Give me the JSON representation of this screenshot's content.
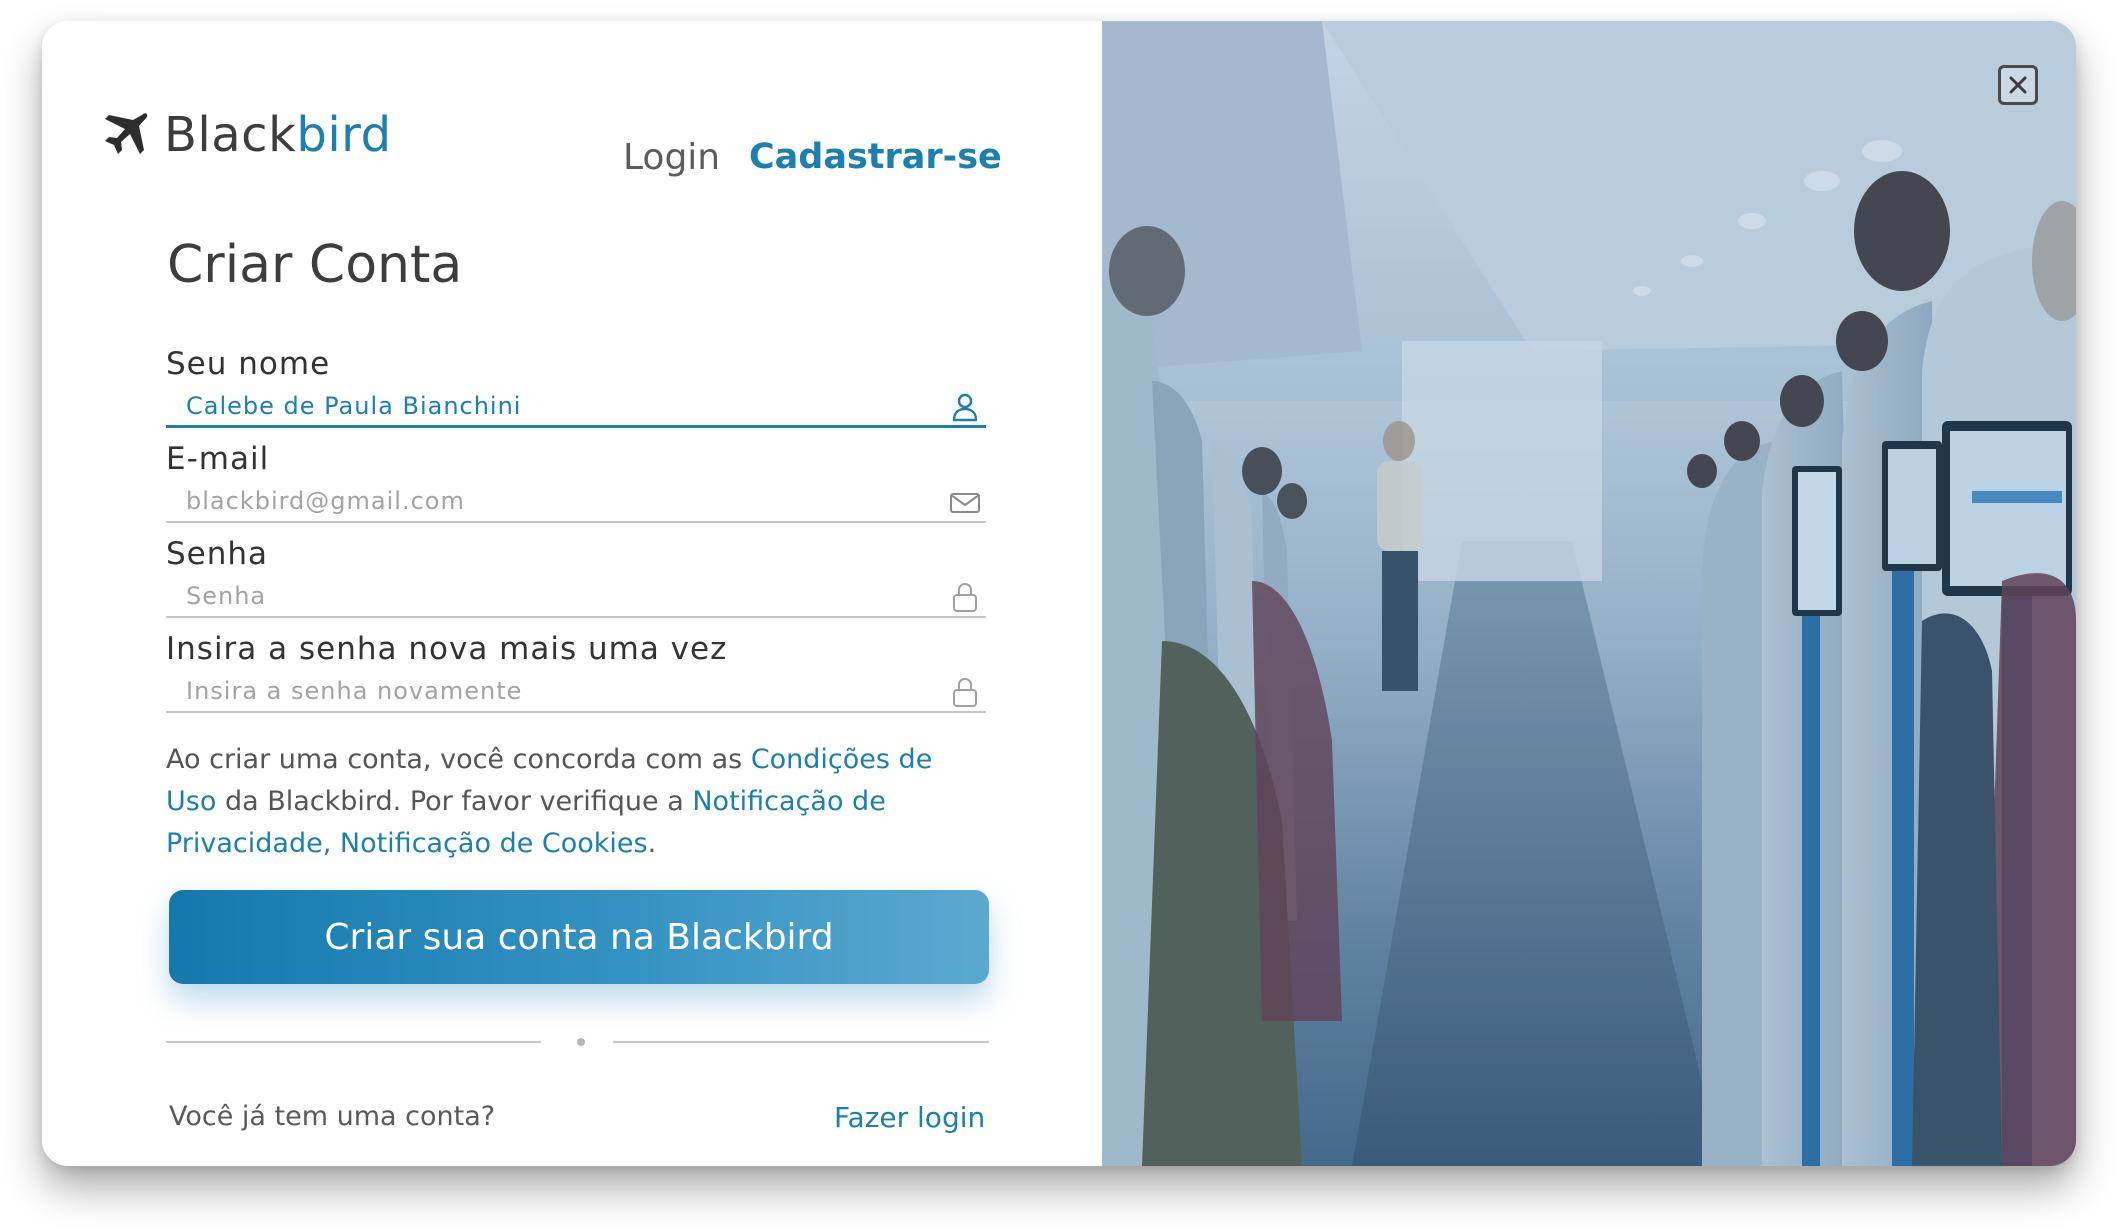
{
  "brand": {
    "name_part1": "Black",
    "name_part2": "bird",
    "icon": "airplane-icon",
    "color": "#1b7fb0"
  },
  "nav": {
    "login_label": "Login",
    "signup_label": "Cadastrar-se"
  },
  "form": {
    "title": "Criar Conta",
    "fields": [
      {
        "label": "Seu nome",
        "value": "Calebe de Paula Bianchini",
        "placeholder": "",
        "icon": "user-icon"
      },
      {
        "label": "E-mail",
        "value": "",
        "placeholder": "blackbird@gmail.com",
        "icon": "mail-icon"
      },
      {
        "label": "Senha",
        "value": "",
        "placeholder": "Senha",
        "icon": "lock-icon"
      },
      {
        "label": "Insira a senha nova mais uma vez",
        "value": "",
        "placeholder": "Insira a senha novamente",
        "icon": "lock-icon"
      }
    ],
    "terms": {
      "text1": "Ao criar uma conta, você concorda com as ",
      "link1": "Condições de Uso",
      "text2": " da Blackbird. Por favor verifique a ",
      "link2": "Notificação de Privacidade, Notificação de Cookies",
      "text3": "."
    },
    "submit_label": "Criar sua conta na Blackbird",
    "have_account": "Você já tem uma conta?",
    "login_link": "Fazer login"
  },
  "image_panel": {
    "description_icon": "airplane-cabin-photo",
    "close_icon": "close-icon"
  }
}
